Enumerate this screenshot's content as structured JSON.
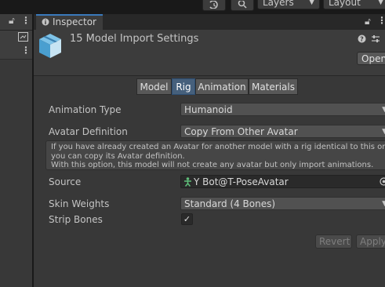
{
  "toolbar": {
    "history_icon": "history-icon",
    "search_icon": "search-icon",
    "layers_label": "Layers",
    "layout_label": "Layout"
  },
  "inspector": {
    "tab_label": "Inspector",
    "title": "15 Model Import Settings",
    "open_label": "Open"
  },
  "tabs": [
    "Model",
    "Rig",
    "Animation",
    "Materials"
  ],
  "active_tab": "Rig",
  "rig": {
    "animation_type_label": "Animation Type",
    "animation_type_value": "Humanoid",
    "avatar_definition_label": "Avatar Definition",
    "avatar_definition_value": "Copy From Other Avatar",
    "help_line1": "If you have already created an Avatar for another model with a rig identical to this one,",
    "help_line2": "you can copy its Avatar definition.",
    "help_line3": "With this option, this model will not create any avatar but only import animations.",
    "source_label": "Source",
    "source_value": "Y Bot@T-PoseAvatar",
    "skin_weights_label": "Skin Weights",
    "skin_weights_value": "Standard (4 Bones)",
    "strip_bones_label": "Strip Bones",
    "strip_bones_checked": true
  },
  "buttons": {
    "revert": "Revert",
    "apply": "Apply"
  },
  "colors": {
    "active_tab": "#46607c",
    "tab_accent": "#3a79bb",
    "background": "#383838"
  }
}
